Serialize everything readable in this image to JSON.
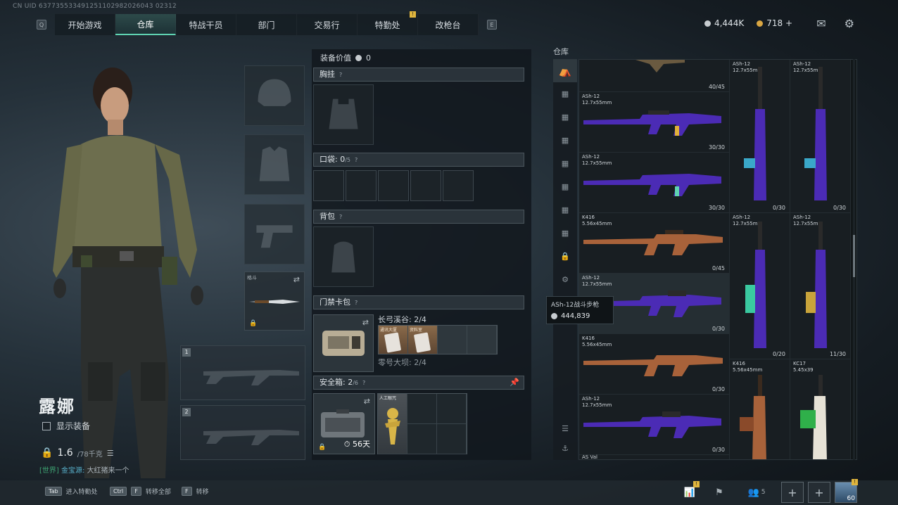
{
  "uid": "CN UID 637735533491251102982026043 02312",
  "nav": {
    "left_key": "Q",
    "right_key": "E",
    "tabs": [
      {
        "label": "开始游戏",
        "active": false
      },
      {
        "label": "仓库",
        "active": true
      },
      {
        "label": "特战干员",
        "active": false
      },
      {
        "label": "部门",
        "active": false
      },
      {
        "label": "交易行",
        "active": false
      },
      {
        "label": "特勤处",
        "active": false,
        "badge": "!"
      },
      {
        "label": "改枪台",
        "active": false
      }
    ]
  },
  "currency": {
    "silver": "4,444K",
    "gold": "718",
    "gold_add": "+"
  },
  "character": {
    "name": "露娜",
    "show_gear_label": "显示装备",
    "weight": "1.6",
    "weight_max": "/78千克",
    "chat_channel": "[世界]",
    "chat_name": "金宝源:",
    "chat_msg": "大红猪来一个"
  },
  "equip": {
    "melee_label": "格斗",
    "slot1": "1",
    "slot2": "2"
  },
  "middle": {
    "value_label": "装备价值",
    "value": "0",
    "chest_label": "胸挂",
    "pocket_label": "口袋:",
    "pocket_count": "0",
    "pocket_max": "/5",
    "backpack_label": "背包",
    "keycard_label": "门禁卡包",
    "keycard_line1": "长弓溪谷: 2/4",
    "keycard_line2": "零号大坝: 2/4",
    "card1_label": "通讯大厦",
    "card2_label": "资料室",
    "safe_label": "安全箱:",
    "safe_count": "2",
    "safe_max": "/6",
    "safe_item_label": "人工眼咒",
    "safe_days": "56天"
  },
  "warehouse": {
    "title": "仓库",
    "items": [
      {
        "name": "",
        "count": "40/45"
      },
      {
        "name": "ASh-12\n12.7x55mm",
        "count": "30/30"
      },
      {
        "name": "ASh-12\n12.7x55mm",
        "count": "30/30"
      },
      {
        "name": "K416\n5.56x45mm",
        "count": "0/45"
      },
      {
        "name": "ASh-12\n12.7x55mm",
        "count": "0/30"
      },
      {
        "name": "K416\n5.56x45mm",
        "count": "0/30"
      },
      {
        "name": "ASh-12\n12.7x55mm",
        "count": "0/30"
      },
      {
        "name": "ASh-12\n12.7x55mm",
        "count": "0/30"
      },
      {
        "name": "ASh-12\n12.7x55mm",
        "count": "0/30"
      },
      {
        "name": "ASh-12\n12.7x55mm",
        "count": "0/20"
      },
      {
        "name": "ASh-12\n12.7x55mm",
        "count": "11/30"
      },
      {
        "name": "K416\n5.56x45mm",
        "count": ""
      },
      {
        "name": "KC17\n5.45x39",
        "count": ""
      }
    ],
    "footer_label": "AS Val"
  },
  "tooltip": {
    "name": "ASh-12战斗步枪",
    "price": "444,839"
  },
  "bottom": {
    "hint1_key": "Tab",
    "hint1_label": "进入特勤处",
    "hint2_key1": "Ctrl",
    "hint2_key2": "F",
    "hint2_label": "转移全部",
    "hint3_key": "F",
    "hint3_label": "转移",
    "squad_count": "5",
    "level": "60"
  },
  "colors": {
    "accent": "#5fd3b2",
    "badge": "#e0b53d",
    "purple": "#5b3fd1"
  }
}
